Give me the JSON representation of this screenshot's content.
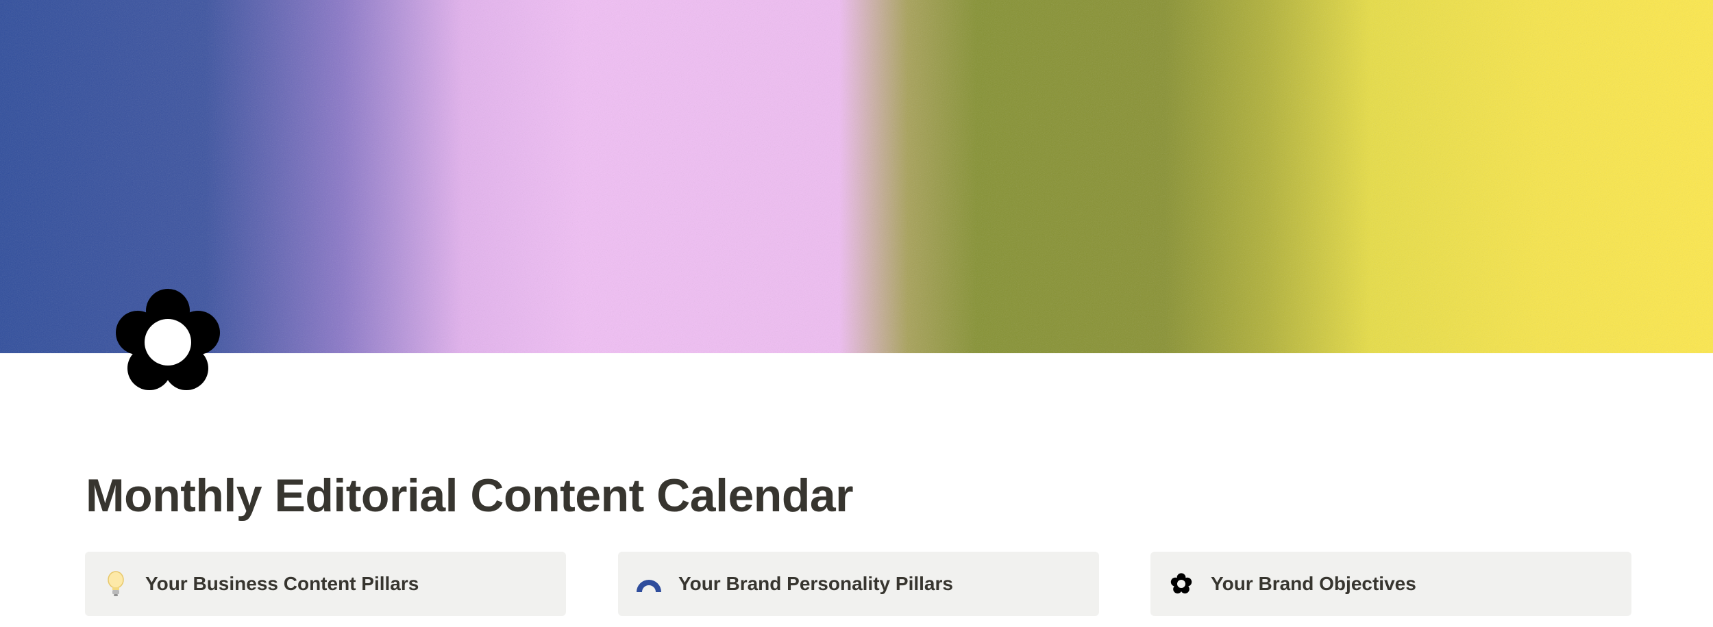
{
  "page": {
    "title": "Monthly Editorial Content Calendar",
    "icon": "flower-icon",
    "cover": {
      "description": "gradient cover",
      "colors": [
        "#2f4d9c",
        "#f1bff5",
        "#869233",
        "#fde84c"
      ]
    }
  },
  "callouts": [
    {
      "icon": "lightbulb-icon",
      "label": "Your Business Content Pillars"
    },
    {
      "icon": "rainbow-arc-icon",
      "label": "Your Brand Personality Pillars",
      "icon_color": "#2f4d9c"
    },
    {
      "icon": "flower-icon",
      "label": "Your Brand Objectives"
    }
  ],
  "colors": {
    "text": "#37352f",
    "callout_bg": "#f1f1ef"
  }
}
